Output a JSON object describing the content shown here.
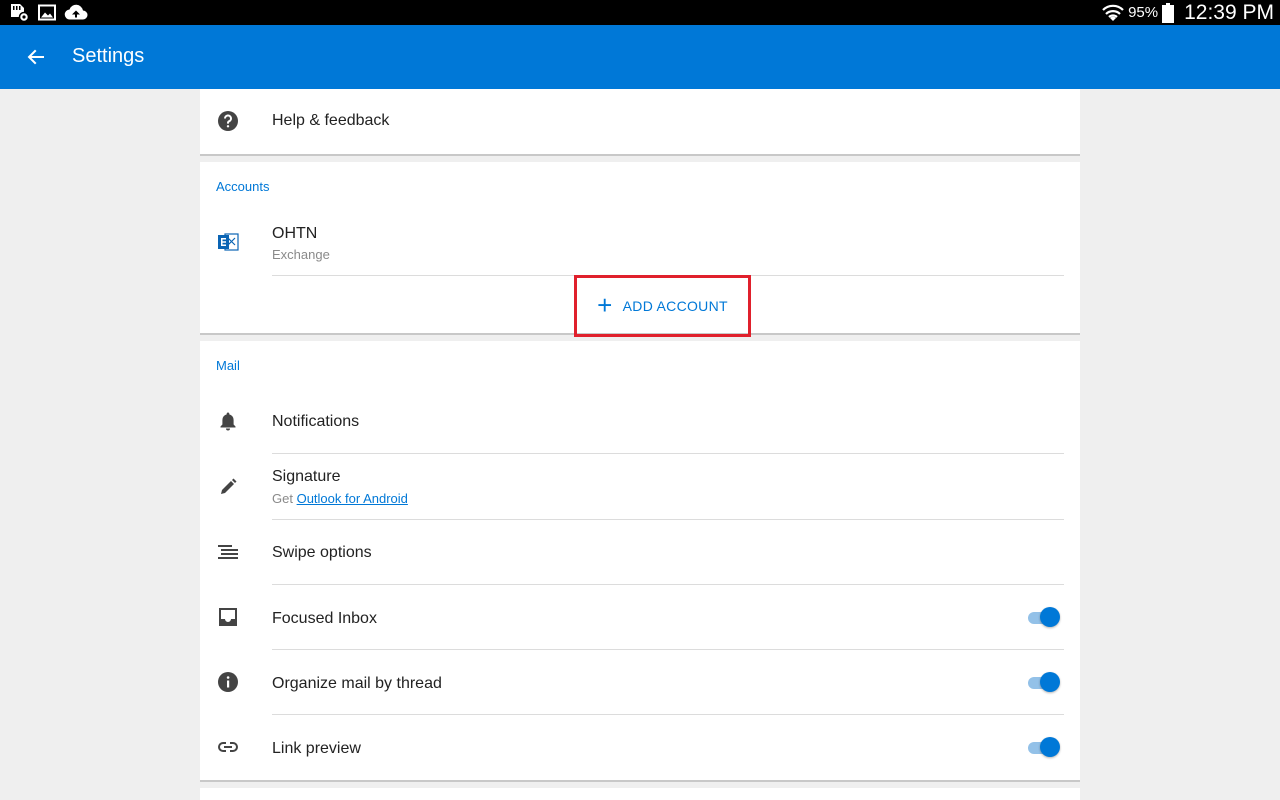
{
  "status_bar": {
    "battery_percent": "95%",
    "time": "12:39 PM"
  },
  "app_bar": {
    "title": "Settings"
  },
  "help": {
    "label": "Help & feedback"
  },
  "accounts": {
    "header": "Accounts",
    "items": [
      {
        "name": "OHTN",
        "type": "Exchange"
      }
    ],
    "add_label": "ADD ACCOUNT"
  },
  "mail": {
    "header": "Mail",
    "notifications": "Notifications",
    "signature": {
      "label": "Signature",
      "sub_prefix": "Get",
      "sub_link": "Outlook for Android"
    },
    "swipe_options": "Swipe options",
    "focused_inbox": {
      "label": "Focused Inbox",
      "on": true
    },
    "organize_by_thread": {
      "label": "Organize mail by thread",
      "on": true
    },
    "link_preview": {
      "label": "Link preview",
      "on": true
    }
  },
  "colors": {
    "accent": "#0078d7",
    "highlight_box": "#e0202c"
  }
}
